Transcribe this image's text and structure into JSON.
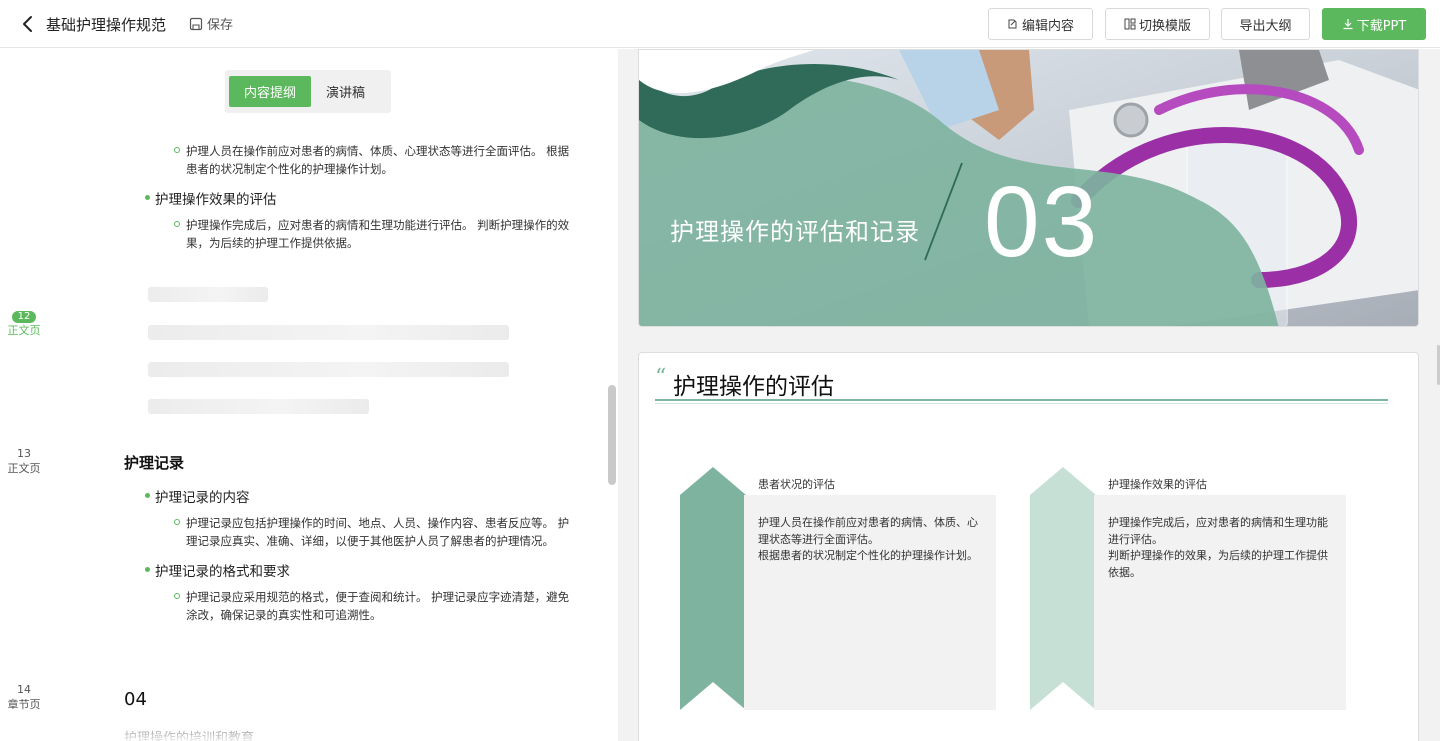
{
  "header": {
    "title": "基础护理操作规范",
    "save_label": "保存",
    "buttons": {
      "edit": "编辑内容",
      "switch_template": "切换模版",
      "export_outline": "导出大纲",
      "download": "下载PPT"
    }
  },
  "left": {
    "tabs": [
      "内容提纲",
      "演讲稿"
    ],
    "active_tab": "内容提纲",
    "outline_top": {
      "sub1": [
        "护理人员在操作前应对患者的病情、体质、心理状态等进行全面评估。 根据",
        "患者的状况制定个性化的护理操作计划。"
      ],
      "bullet1": "护理操作效果的评估",
      "sub2": [
        "护理操作完成后，应对患者的病情和生理功能进行评估。 判断护理操作的效",
        "果，为后续的护理工作提供依据。"
      ]
    },
    "page_markers": [
      {
        "num": "12",
        "type": "正文页"
      },
      {
        "num": "13",
        "type": "正文页"
      },
      {
        "num": "14",
        "type": "章节页"
      }
    ],
    "section13": {
      "title": "护理记录",
      "bullet1": "护理记录的内容",
      "sub1": [
        "护理记录应包括护理操作的时间、地点、人员、操作内容、患者反应等。 护",
        "理记录应真实、准确、详细，以便于其他医护人员了解患者的护理情况。"
      ],
      "bullet2": "护理记录的格式和要求",
      "sub2": [
        "护理记录应采用规范的格式，便于查阅和统计。 护理记录应字迹清楚，避免",
        "涂改，确保记录的真实性和可追溯性。"
      ]
    },
    "section14": {
      "number": "04",
      "title": "护理操作的培训和教育"
    }
  },
  "slides": {
    "slide1": {
      "title": "护理操作的评估和记录",
      "number": "03"
    },
    "slide2": {
      "title": "护理操作的评估",
      "cards": [
        {
          "title": "患者状况的评估",
          "lines": [
            "护理人员在操作前应对患者的病情、体质、心",
            "理状态等进行全面评估。",
            "根据患者的状况制定个性化的护理操作计划。"
          ]
        },
        {
          "title": "护理操作效果的评估",
          "lines": [
            "护理操作完成后，应对患者的病情和生理功能",
            "进行评估。",
            "判断护理操作的效果，为后续的护理工作提供",
            "依据。"
          ]
        }
      ]
    }
  },
  "colors": {
    "accent": "#5cb85c",
    "teal_dark": "#2f6b58",
    "teal": "#7db39f",
    "teal_light": "#c6e0d6"
  }
}
